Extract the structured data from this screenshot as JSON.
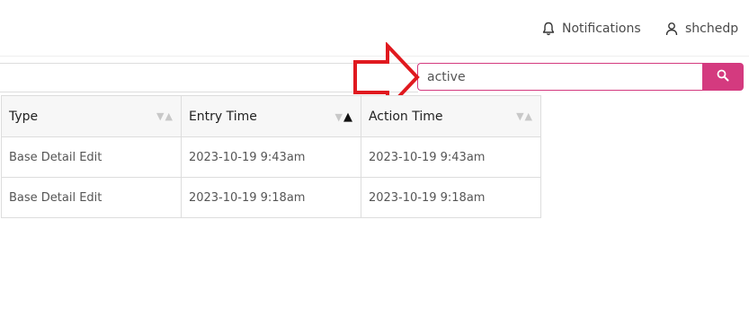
{
  "nav": {
    "notifications_label": "Notifications",
    "user_label": "shchedp"
  },
  "search": {
    "value": "active"
  },
  "table": {
    "columns": [
      {
        "label": "Type",
        "sort": "none"
      },
      {
        "label": "Entry Time",
        "sort": "asc"
      },
      {
        "label": "Action Time",
        "sort": "none"
      }
    ],
    "rows": [
      [
        "Base Detail Edit",
        "2023-10-19 9:43am",
        "2023-10-19 9:43am"
      ],
      [
        "Base Detail Edit",
        "2023-10-19 9:18am",
        "2023-10-19 9:18am"
      ]
    ]
  },
  "colors": {
    "accent": "#d43a7f",
    "annotation_arrow": "#e0191f"
  },
  "icons": {
    "notifications": "bell-icon",
    "user": "user-icon",
    "search": "search-icon",
    "sort_desc": "triangle-down-icon",
    "sort_asc": "triangle-up-icon"
  }
}
